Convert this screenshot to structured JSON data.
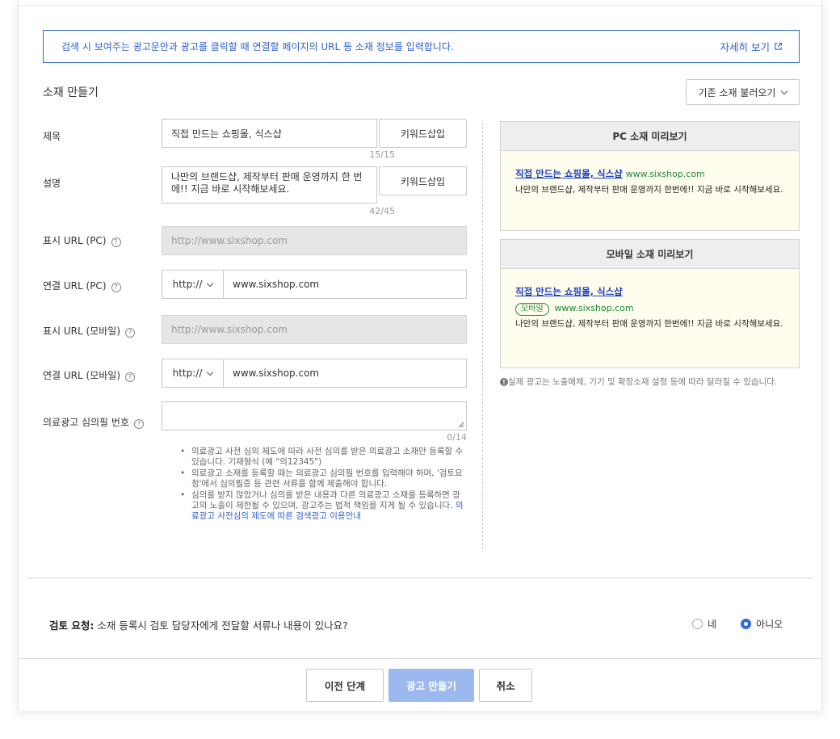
{
  "notice": {
    "text": "검색 시 보여주는 광고문안과 광고를 클릭할 때 연결할 페이지의 URL 등 소재 정보를 입력합니다.",
    "link_label": "자세히 보기"
  },
  "section": {
    "title": "소재 만들기",
    "load_button": "기존 소재 불러오기"
  },
  "form": {
    "title": {
      "label": "제목",
      "value": "직접 만드는 쇼핑몰, 식스샵",
      "counter": "15/15",
      "keyword_button": "키워드삽입"
    },
    "description": {
      "label": "설명",
      "value": "나만의 브랜드샵, 제작부터 판매 운영까지 한 번에!! 지금 바로 시작해보세요.",
      "counter": "42/45",
      "keyword_button": "키워드삽입"
    },
    "display_url_pc": {
      "label": "표시 URL (PC)",
      "value": "http://www.sixshop.com"
    },
    "link_url_pc": {
      "label": "연결 URL (PC)",
      "protocol": "http://",
      "value": "www.sixshop.com"
    },
    "display_url_mobile": {
      "label": "표시 URL (모바일)",
      "value": "http://www.sixshop.com"
    },
    "link_url_mobile": {
      "label": "연결 URL (모바일)",
      "protocol": "http://",
      "value": "www.sixshop.com"
    },
    "medical": {
      "label": "의료광고 심의필 번호",
      "value": "",
      "counter": "0/14"
    },
    "help_icon": "?"
  },
  "notes": {
    "items": [
      "의료광고 사전 심의 제도에 따라 사전 심의를 받은 의료광고 소재만 등록할 수 있습니다. 기재형식 (예 \"의12345\")",
      "의료광고 소재를 등록할 때는 의료광고 심의필 번호를 입력해야 하며, '검토요청'에서 심의필증 등 관련 서류를 함께 제출해야 합니다.",
      "심의를 받지 않았거나 심의를 받은 내용과 다른 의료광고 소재를 등록하면 광고의 노출이 제한될 수 있으며, 광고주는 법적 책임을 지게 될 수 있습니다."
    ],
    "link": "의료광고 사전심의 제도에 따른 검색광고 이용안내"
  },
  "preview": {
    "pc": {
      "header": "PC 소재 미리보기",
      "title": "직접 만드는 쇼핑몰, 식스샵",
      "url": "www.sixshop.com",
      "desc": "나만의 브랜드샵, 제작부터 판매 운영까지 한번에!! 지금 바로 시작해보세요."
    },
    "mobile": {
      "header": "모바일 소재 미리보기",
      "title": "직접 만드는 쇼핑몰, 식스샵",
      "tag": "모바일",
      "url": "www.sixshop.com",
      "desc": "나만의 브랜드샵, 제작부터 판매 운영까지 한번에!! 지금 바로 시작해보세요."
    },
    "note": "실제 광고는 노출매체, 기기 및 확장소재 설정 등에 따라 달라질 수 있습니다.",
    "note_icon": "!"
  },
  "review": {
    "label": "검토 요청:",
    "question": "소재 등록시 검토 담당자에게 전달할 서류나 내용이 있나요?",
    "yes": "네",
    "no": "아니오",
    "selected": "no"
  },
  "footer": {
    "prev": "이전 단계",
    "make": "광고 만들기",
    "cancel": "취소"
  },
  "colors": {
    "accent": "#2f6bdd",
    "link": "#2f5fcf",
    "preview_bg": "#fffded",
    "url_green": "#1c8a3a",
    "primary_disabled": "#9bb9ef"
  }
}
